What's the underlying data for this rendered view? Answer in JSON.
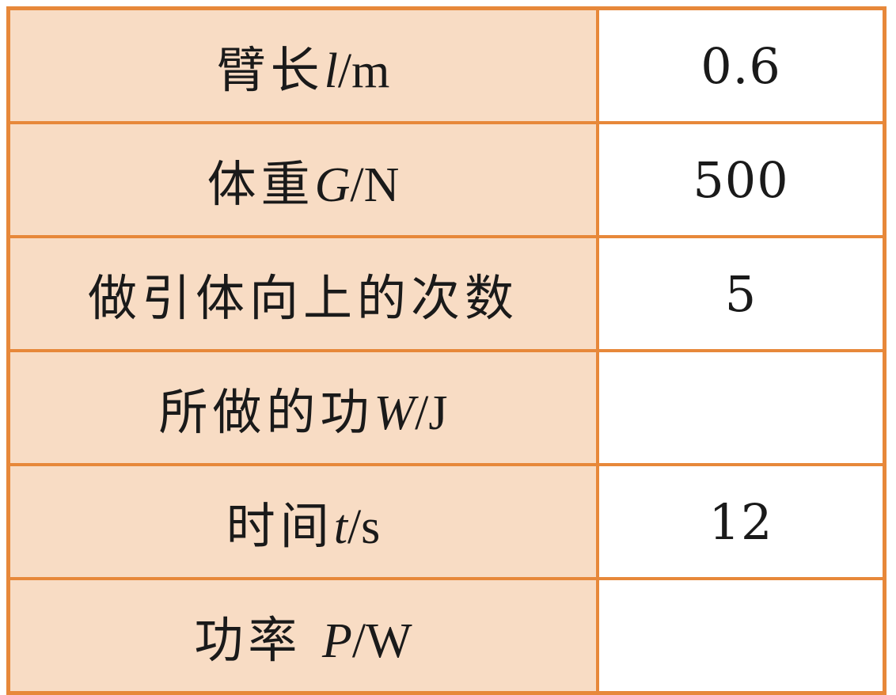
{
  "table": {
    "rows": [
      {
        "label_text": "臂长",
        "symbol": "l",
        "unit": "/m",
        "value": "0.6"
      },
      {
        "label_text": "体重",
        "symbol": "G",
        "unit": "/N",
        "value": "500"
      },
      {
        "label_text": "做引体向上的次数",
        "symbol": "",
        "unit": "",
        "value": "5"
      },
      {
        "label_text": "所做的功",
        "symbol": "W",
        "unit": "/J",
        "value": ""
      },
      {
        "label_text": "时间",
        "symbol": "t",
        "unit": "/s",
        "value": "12"
      },
      {
        "label_text": "功率 ",
        "symbol": "P",
        "unit": "/W",
        "value": ""
      }
    ]
  },
  "colors": {
    "border": "#e7883a",
    "label_background": "#f8dcc4",
    "value_background": "#ffffff"
  }
}
